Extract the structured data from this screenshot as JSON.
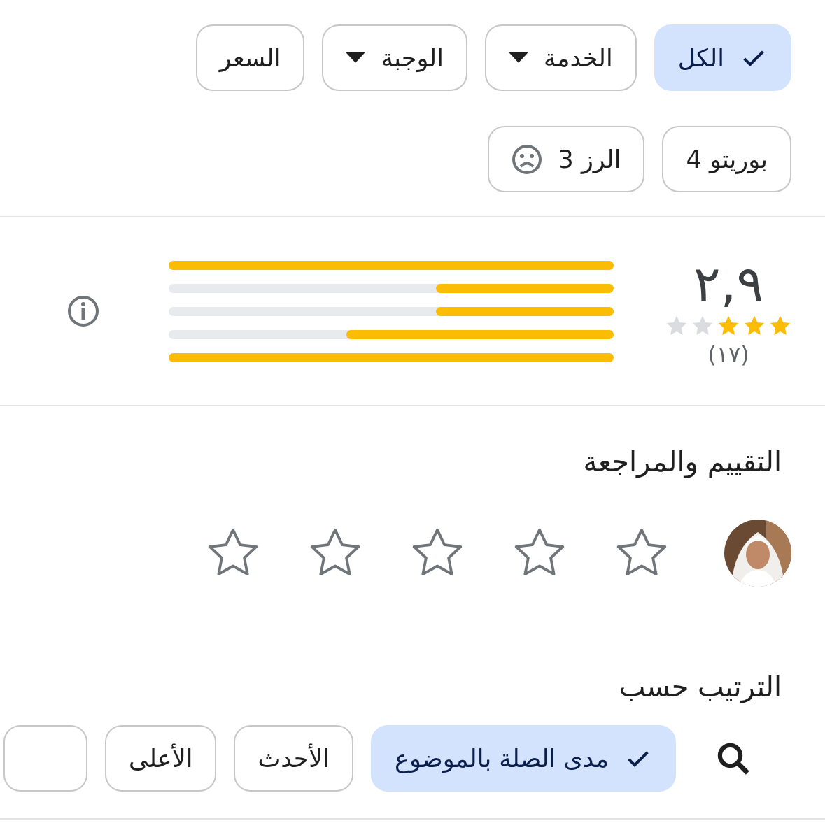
{
  "filters": [
    {
      "label": "الكل",
      "kind": "plain",
      "selected": true
    },
    {
      "label": "الخدمة",
      "kind": "dropdown",
      "selected": false
    },
    {
      "label": "الوجبة",
      "kind": "dropdown",
      "selected": false
    },
    {
      "label": "السعر",
      "kind": "plain",
      "selected": false
    }
  ],
  "topics": [
    {
      "label": "بوريتو 4",
      "kind": "plain"
    },
    {
      "label": "الرز 3",
      "kind": "negative"
    }
  ],
  "summary": {
    "score": "٢,٩",
    "stars": 3,
    "count": "(١٧)",
    "bars": [
      {
        "level": 1
      },
      {
        "level": 0.4
      },
      {
        "level": 0.4
      },
      {
        "level": 0.6
      },
      {
        "level": 1
      }
    ]
  },
  "rate": {
    "title": "التقييم والمراجعة",
    "stars": 0
  },
  "sort": {
    "title": "الترتيب حسب",
    "options": [
      {
        "label": "مدى الصلة بالموضوع",
        "selected": true
      },
      {
        "label": "الأحدث",
        "selected": false
      },
      {
        "label": "الأعلى",
        "selected": false
      }
    ]
  }
}
